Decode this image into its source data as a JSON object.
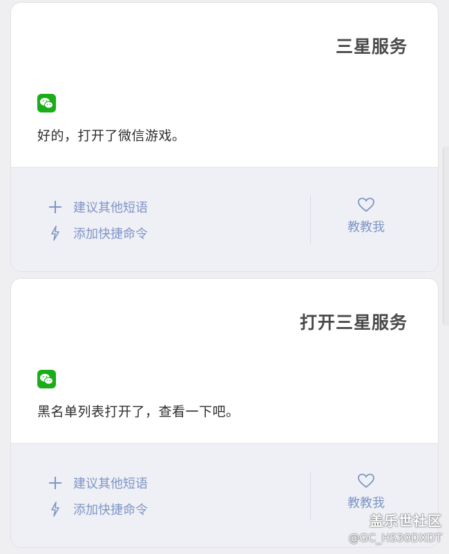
{
  "cards": [
    {
      "query": "三星服务",
      "app_icon": "wechat-icon",
      "reply": "好的，打开了微信游戏。",
      "actions": {
        "suggest_label": "建议其他短语",
        "shortcut_label": "添加快捷命令",
        "teach_label": "教教我"
      }
    },
    {
      "query": "打开三星服务",
      "app_icon": "wechat-icon",
      "reply": "黑名单列表打开了，查看一下吧。",
      "actions": {
        "suggest_label": "建议其他短语",
        "shortcut_label": "添加快捷命令",
        "teach_label": "教教我"
      }
    }
  ],
  "watermark": {
    "line1": "盖乐世社区",
    "line2": "@GC_HS30DXDT"
  },
  "colors": {
    "action_blue": "#7f94c6",
    "wechat_green": "#1aad19",
    "action_bar_bg": "#eef0f5"
  }
}
